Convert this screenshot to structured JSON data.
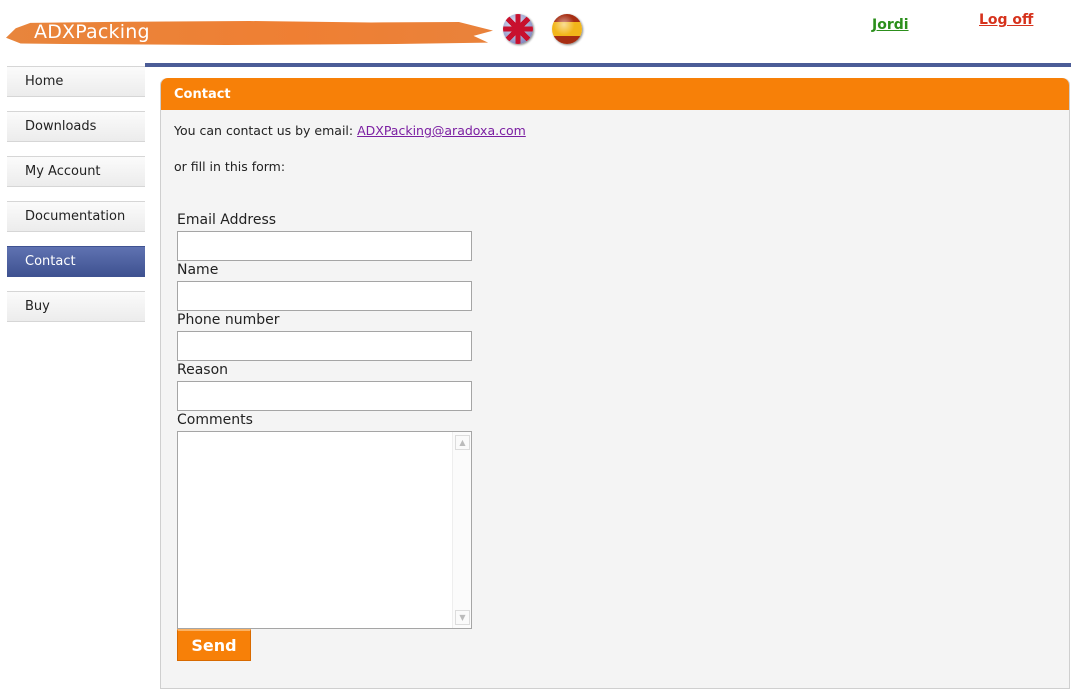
{
  "header": {
    "logo_text": "ADXPacking",
    "user_name": "Jordi",
    "logoff_label": "Log off",
    "flags": [
      "uk-flag-icon",
      "spain-flag-icon"
    ]
  },
  "sidebar": {
    "items": [
      {
        "label": "Home",
        "active": false
      },
      {
        "label": "Downloads",
        "active": false
      },
      {
        "label": "My Account",
        "active": false
      },
      {
        "label": "Documentation",
        "active": false
      },
      {
        "label": "Contact",
        "active": true
      },
      {
        "label": "Buy",
        "active": false
      }
    ]
  },
  "contact": {
    "title": "Contact",
    "intro_text": "You can contact us by email: ",
    "email": "ADXPacking@aradoxa.com",
    "or_text": "or fill in this form:",
    "fields": {
      "email_label": "Email Address",
      "email_value": "",
      "name_label": "Name",
      "name_value": "",
      "phone_label": "Phone number",
      "phone_value": "",
      "reason_label": "Reason",
      "reason_value": "",
      "comments_label": "Comments",
      "comments_value": ""
    },
    "send_label": "Send"
  },
  "colors": {
    "accent": "#f78008",
    "nav_active": "#4b5c97",
    "user_link": "#2c8f1c",
    "logoff_link": "#d6321c"
  }
}
